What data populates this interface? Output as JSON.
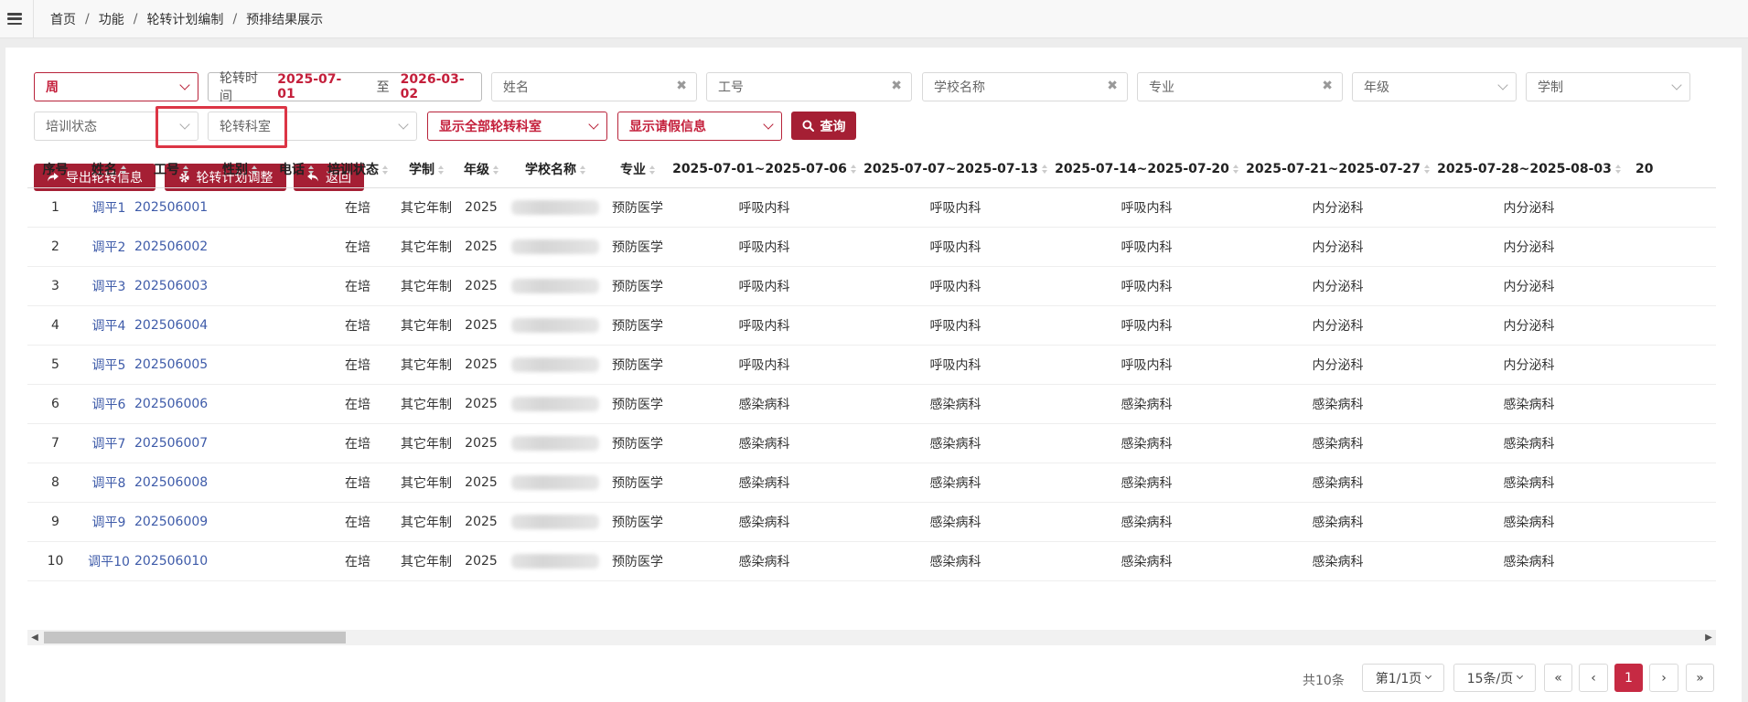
{
  "breadcrumb": [
    "首页",
    "功能",
    "轮转计划编制",
    "预排结果展示"
  ],
  "filters": {
    "period": "周",
    "date_label": "轮转时间",
    "date_start": "2025-07-01",
    "date_to": "至",
    "date_end": "2026-03-02",
    "name_placeholder": "姓名",
    "job_no_placeholder": "工号",
    "school_placeholder": "学校名称",
    "major_placeholder": "专业",
    "grade_placeholder": "年级",
    "system_placeholder": "学制",
    "status_placeholder": "培训状态",
    "dept_placeholder": "轮转科室",
    "show_all_depts": "显示全部轮转科室",
    "show_leave": "显示请假信息",
    "query_label": "查询"
  },
  "actions": {
    "export_label": "导出轮转信息",
    "adjust_label": "轮转计划调整",
    "back_label": "返回"
  },
  "table": {
    "headers": [
      "序号",
      "姓名",
      "工号",
      "性别",
      "电话",
      "培训状态",
      "学制",
      "年级",
      "学校名称",
      "专业",
      "2025-07-01~2025-07-06",
      "2025-07-07~2025-07-13",
      "2025-07-14~2025-07-20",
      "2025-07-21~2025-07-27",
      "2025-07-28~2025-08-03",
      "20"
    ],
    "rows": [
      [
        "1",
        "调平1",
        "202506001",
        "",
        "",
        "在培",
        "其它年制",
        "2025",
        "",
        "预防医学",
        "呼吸内科",
        "呼吸内科",
        "呼吸内科",
        "内分泌科",
        "内分泌科",
        ""
      ],
      [
        "2",
        "调平2",
        "202506002",
        "",
        "",
        "在培",
        "其它年制",
        "2025",
        "",
        "预防医学",
        "呼吸内科",
        "呼吸内科",
        "呼吸内科",
        "内分泌科",
        "内分泌科",
        ""
      ],
      [
        "3",
        "调平3",
        "202506003",
        "",
        "",
        "在培",
        "其它年制",
        "2025",
        "",
        "预防医学",
        "呼吸内科",
        "呼吸内科",
        "呼吸内科",
        "内分泌科",
        "内分泌科",
        ""
      ],
      [
        "4",
        "调平4",
        "202506004",
        "",
        "",
        "在培",
        "其它年制",
        "2025",
        "",
        "预防医学",
        "呼吸内科",
        "呼吸内科",
        "呼吸内科",
        "内分泌科",
        "内分泌科",
        ""
      ],
      [
        "5",
        "调平5",
        "202506005",
        "",
        "",
        "在培",
        "其它年制",
        "2025",
        "",
        "预防医学",
        "呼吸内科",
        "呼吸内科",
        "呼吸内科",
        "内分泌科",
        "内分泌科",
        ""
      ],
      [
        "6",
        "调平6",
        "202506006",
        "",
        "",
        "在培",
        "其它年制",
        "2025",
        "",
        "预防医学",
        "感染病科",
        "感染病科",
        "感染病科",
        "感染病科",
        "感染病科",
        ""
      ],
      [
        "7",
        "调平7",
        "202506007",
        "",
        "",
        "在培",
        "其它年制",
        "2025",
        "",
        "预防医学",
        "感染病科",
        "感染病科",
        "感染病科",
        "感染病科",
        "感染病科",
        ""
      ],
      [
        "8",
        "调平8",
        "202506008",
        "",
        "",
        "在培",
        "其它年制",
        "2025",
        "",
        "预防医学",
        "感染病科",
        "感染病科",
        "感染病科",
        "感染病科",
        "感染病科",
        ""
      ],
      [
        "9",
        "调平9",
        "202506009",
        "",
        "",
        "在培",
        "其它年制",
        "2025",
        "",
        "预防医学",
        "感染病科",
        "感染病科",
        "感染病科",
        "感染病科",
        "感染病科",
        ""
      ],
      [
        "10",
        "调平10",
        "202506010",
        "",
        "",
        "在培",
        "其它年制",
        "2025",
        "",
        "预防医学",
        "感染病科",
        "感染病科",
        "感染病科",
        "感染病科",
        "感染病科",
        ""
      ]
    ]
  },
  "pagination": {
    "total": "共10条",
    "page_select": "第1/1页",
    "size_select": "15条/页",
    "first": "«",
    "prev": "‹",
    "current": "1",
    "next": "›",
    "last": "»"
  },
  "colors": {
    "accent": "#a51f34",
    "link": "#3e5ba9"
  }
}
